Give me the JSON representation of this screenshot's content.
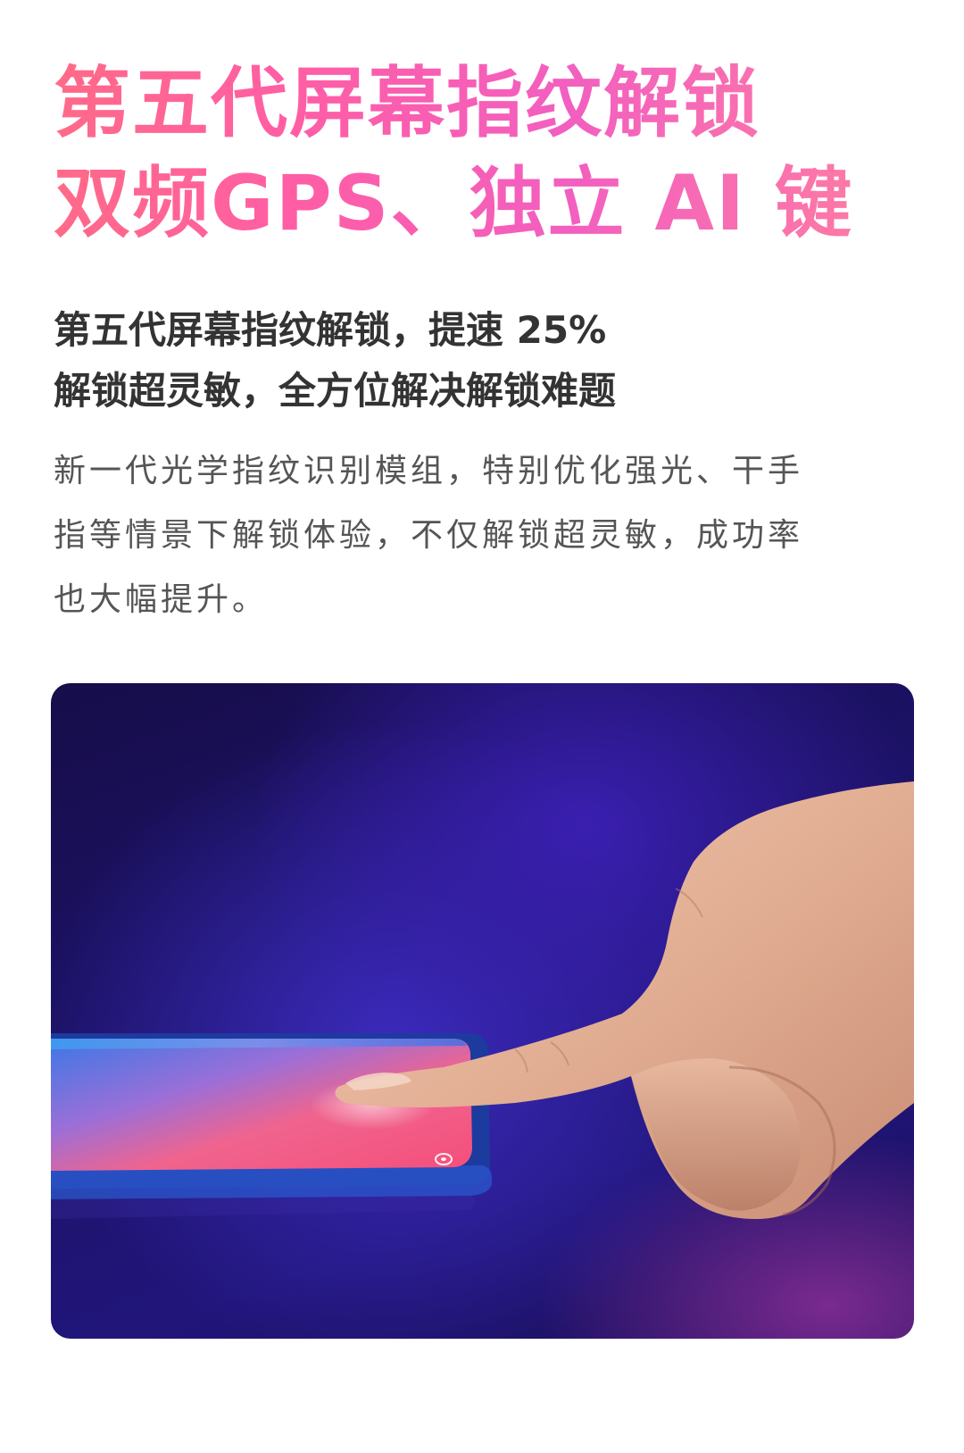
{
  "hero": {
    "line1": "第五代屏幕指纹解锁",
    "line2": "双频GPS、独立 AI 键"
  },
  "subheading": {
    "line1": "第五代屏幕指纹解锁，提速 25%",
    "line2": "解锁超灵敏，全方位解决解锁难题"
  },
  "description": {
    "line1": "新一代光学指纹识别模组，特别优化强光、干手",
    "line2": "指等情景下解锁体验，不仅解锁超灵敏，成功率",
    "line3": "也大幅提升。"
  },
  "image": {
    "subject": "finger-pressing-in-display-fingerprint-sensor",
    "colors": {
      "background": "#1c1266",
      "screen_pink": "#f2628c",
      "screen_blue": "#4a7ee8",
      "skin": "#e6b49a"
    }
  },
  "theme": {
    "accent_gradient": [
      "#ff6a88",
      "#ff5ea5",
      "#f25fc0",
      "#ff7ea1"
    ]
  }
}
